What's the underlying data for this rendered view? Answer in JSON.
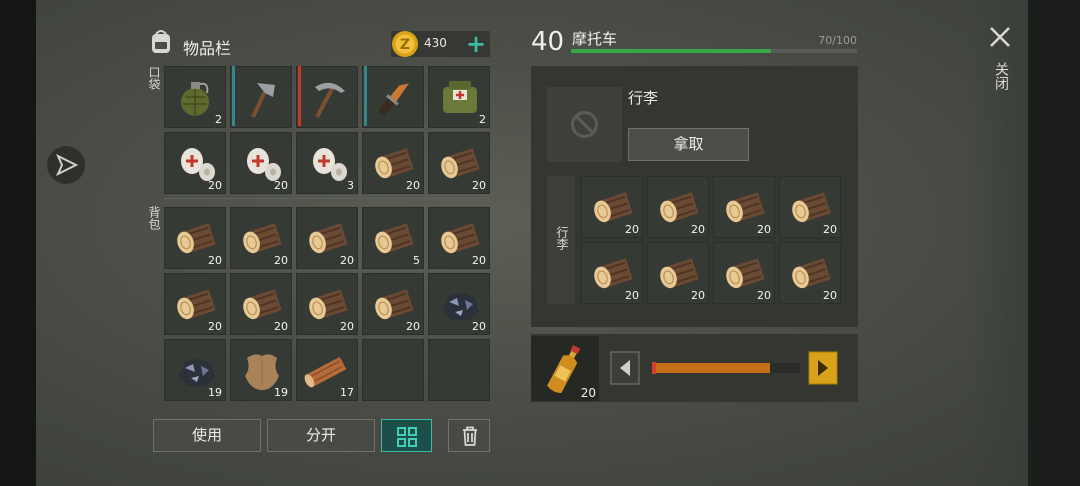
{
  "inventory": {
    "title": "物品栏",
    "coins": "430",
    "pocket_label": "口袋",
    "backpack_label": "背包",
    "pocket": [
      {
        "icon": "grenade",
        "count": "2"
      },
      {
        "icon": "hatchet",
        "count": "",
        "durability": "#2f8a8a"
      },
      {
        "icon": "pickaxe",
        "count": "",
        "durability": "#c0392b"
      },
      {
        "icon": "knife",
        "count": "",
        "durability": "#2f8a8a"
      },
      {
        "icon": "medkit",
        "count": "2"
      },
      {
        "icon": "bandage",
        "count": "20"
      },
      {
        "icon": "bandage",
        "count": "20"
      },
      {
        "icon": "bandage",
        "count": "3"
      },
      {
        "icon": "log",
        "count": "20"
      },
      {
        "icon": "log",
        "count": "20"
      }
    ],
    "backpack": [
      {
        "icon": "log",
        "count": "20"
      },
      {
        "icon": "log",
        "count": "20"
      },
      {
        "icon": "log",
        "count": "20"
      },
      {
        "icon": "log",
        "count": "5"
      },
      {
        "icon": "log",
        "count": "20"
      },
      {
        "icon": "log",
        "count": "20"
      },
      {
        "icon": "log",
        "count": "20"
      },
      {
        "icon": "log",
        "count": "20"
      },
      {
        "icon": "log",
        "count": "20"
      },
      {
        "icon": "ore",
        "count": "20"
      },
      {
        "icon": "ore",
        "count": "19"
      },
      {
        "icon": "hide",
        "count": "19"
      },
      {
        "icon": "plank",
        "count": "17"
      },
      {
        "icon": "",
        "count": ""
      },
      {
        "icon": "",
        "count": ""
      }
    ],
    "use_label": "使用",
    "split_label": "分开"
  },
  "vehicle": {
    "level": "40",
    "name": "摩托车",
    "capacity": "70/100",
    "capacity_fraction": 0.7,
    "luggage_title": "行李",
    "take_label": "拿取",
    "side_label": "行李",
    "items": [
      {
        "icon": "log",
        "count": "20"
      },
      {
        "icon": "log",
        "count": "20"
      },
      {
        "icon": "log",
        "count": "20"
      },
      {
        "icon": "log",
        "count": "20"
      },
      {
        "icon": "log",
        "count": "20"
      },
      {
        "icon": "log",
        "count": "20"
      },
      {
        "icon": "log",
        "count": "20"
      },
      {
        "icon": "log",
        "count": "20"
      }
    ]
  },
  "fuel": {
    "icon": "fuel-bottle",
    "count": "20",
    "slider_fraction": 0.8
  },
  "close_label": "关闭",
  "colors": {
    "accent": "#3fb8a4",
    "green": "#3aa64a",
    "orange": "#c56f17",
    "gold": "#d9a21a"
  }
}
